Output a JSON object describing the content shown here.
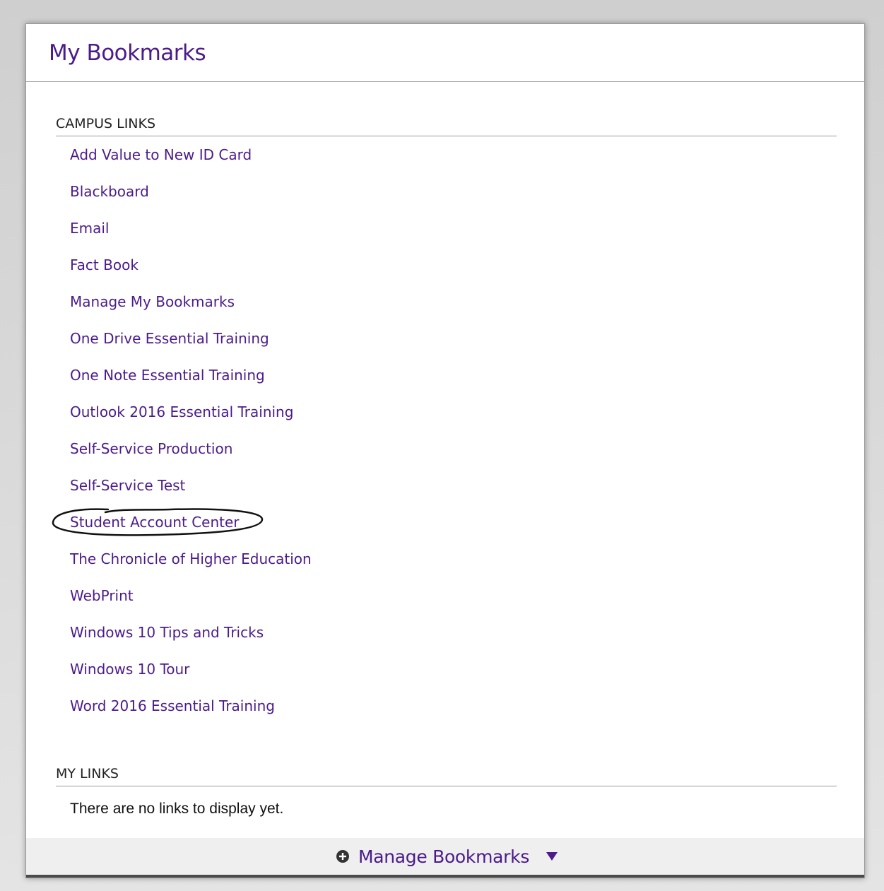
{
  "panel": {
    "title": "My Bookmarks"
  },
  "campus_links": {
    "heading": "CAMPUS LINKS",
    "items": [
      {
        "label": "Add Value to New ID Card"
      },
      {
        "label": "Blackboard"
      },
      {
        "label": "Email"
      },
      {
        "label": "Fact Book"
      },
      {
        "label": "Manage My Bookmarks"
      },
      {
        "label": "One Drive Essential Training"
      },
      {
        "label": "One Note Essential Training"
      },
      {
        "label": "Outlook 2016 Essential Training"
      },
      {
        "label": "Self-Service Production"
      },
      {
        "label": "Self-Service Test"
      },
      {
        "label": "Student Account Center"
      },
      {
        "label": "The Chronicle of Higher Education"
      },
      {
        "label": "WebPrint"
      },
      {
        "label": "Windows 10 Tips and Tricks"
      },
      {
        "label": "Windows 10 Tour"
      },
      {
        "label": "Word 2016 Essential Training"
      }
    ]
  },
  "my_links": {
    "heading": "MY LINKS",
    "empty_message": "There are no links to display yet."
  },
  "footer": {
    "manage_label": "Manage Bookmarks"
  },
  "colors": {
    "accent": "#4b1b8c",
    "text": "#222222",
    "footer_bg": "#efefef"
  },
  "icons": {
    "manage": "plus-circle-icon",
    "dropdown": "caret-down-icon"
  }
}
